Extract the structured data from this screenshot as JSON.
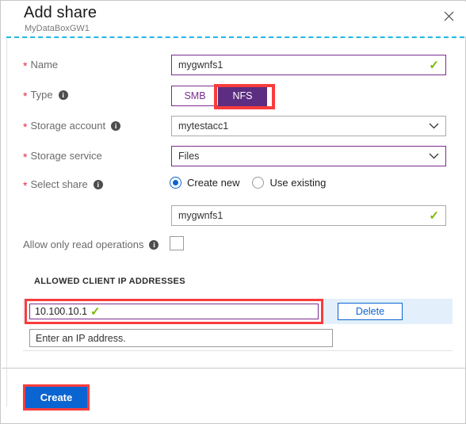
{
  "header": {
    "title": "Add share",
    "subtitle": "MyDataBoxGW1",
    "close_label": "✕"
  },
  "form": {
    "name": {
      "label": "Name",
      "required_mark": "*",
      "value": "mygwnfs1",
      "valid_mark": "✓"
    },
    "type": {
      "label": "Type",
      "required_mark": "*",
      "info_mark": "i",
      "options": [
        "SMB",
        "NFS"
      ],
      "selected": "NFS"
    },
    "storage_account": {
      "label": "Storage account",
      "required_mark": "*",
      "info_mark": "i",
      "value": "mytestacc1"
    },
    "storage_service": {
      "label": "Storage service",
      "required_mark": "*",
      "value": "Files"
    },
    "select_share": {
      "label": "Select share",
      "required_mark": "*",
      "info_mark": "i",
      "options": [
        "Create new",
        "Use existing"
      ],
      "selected": "Create new",
      "share_name_value": "mygwnfs1",
      "valid_mark": "✓"
    },
    "read_only": {
      "label": "Allow only read operations",
      "info_mark": "i",
      "checked": false
    }
  },
  "allowed_ips": {
    "section_title": "ALLOWED CLIENT IP ADDRESSES",
    "entries": [
      {
        "value": "10.100.10.1",
        "valid_mark": "✓",
        "delete_label": "Delete"
      }
    ],
    "new_entry_placeholder": "Enter an IP address."
  },
  "footer": {
    "create_label": "Create"
  },
  "colors": {
    "accent_purple": "#5c2d80",
    "field_purple": "#7b2d8e",
    "primary_blue": "#0a64d2",
    "highlight_red": "#fa3c3c",
    "valid_green": "#7bb800",
    "required_red": "#e8283f",
    "dashed_cyan": "#22b6e6",
    "row_highlight": "#e3f0fb"
  }
}
